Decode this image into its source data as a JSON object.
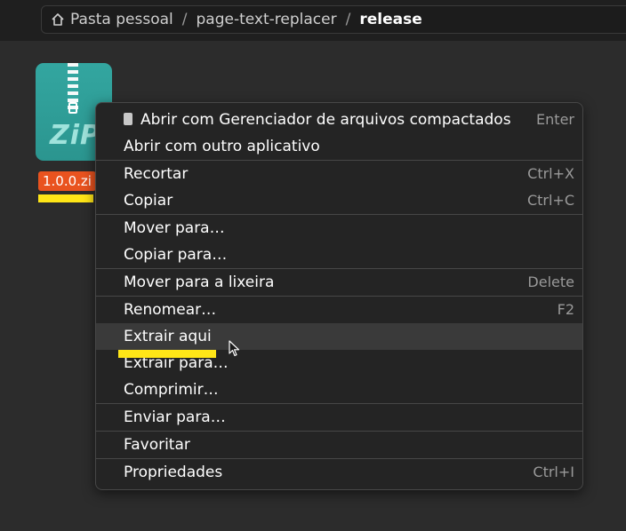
{
  "breadcrumb": {
    "home_icon": "home-icon",
    "segments": [
      "Pasta pessoal",
      "page-text-replacer"
    ],
    "separator": "/",
    "current": "release"
  },
  "file": {
    "icon": "zip-archive-icon",
    "icon_text": "ZiP",
    "name": "1.0.0.zi"
  },
  "menu": {
    "items": [
      {
        "label": "Abrir com Gerenciador de arquivos compactados",
        "shortcut": "Enter",
        "icon": "archive-icon"
      },
      {
        "label": "Abrir com outro aplicativo",
        "shortcut": ""
      },
      {
        "label": "Recortar",
        "shortcut": "Ctrl+X"
      },
      {
        "label": "Copiar",
        "shortcut": "Ctrl+C"
      },
      {
        "label": "Mover para…",
        "shortcut": ""
      },
      {
        "label": "Copiar para…",
        "shortcut": ""
      },
      {
        "label": "Mover para a lixeira",
        "shortcut": "Delete"
      },
      {
        "label": "Renomear…",
        "shortcut": "F2"
      },
      {
        "label": "Extrair aqui",
        "shortcut": "",
        "active": true
      },
      {
        "label": "Extrair para…",
        "shortcut": ""
      },
      {
        "label": "Comprimir…",
        "shortcut": ""
      },
      {
        "label": "Enviar para…",
        "shortcut": ""
      },
      {
        "label": "Favoritar",
        "shortcut": ""
      },
      {
        "label": "Propriedades",
        "shortcut": "Ctrl+I"
      }
    ]
  },
  "colors": {
    "highlight": "#ffe617",
    "file_label_bg": "#e9531f",
    "zip_icon_bg": "#33a6a0",
    "menu_bg": "#242424"
  }
}
